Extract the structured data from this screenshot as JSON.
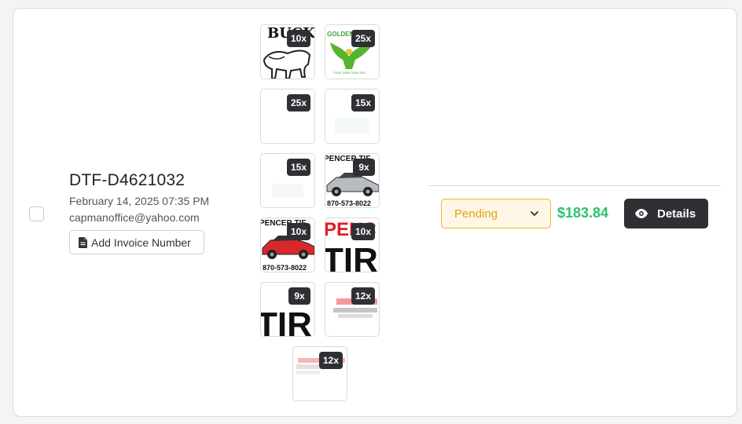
{
  "order": {
    "id": "DTF-D4621032",
    "date": "February 14, 2025 07:35 PM",
    "email": "capmanoffice@yahoo.com",
    "invoice_button": "Add Invoice Number"
  },
  "thumbnails": [
    {
      "qty": "10x",
      "art": "BUCK"
    },
    {
      "qty": "25x",
      "art_title": "GOLDEN",
      "art_sub": "STATE SWIM TEAM 2025"
    },
    {
      "qty": "25x"
    },
    {
      "qty": "15x"
    },
    {
      "qty": "15x"
    },
    {
      "qty": "9x",
      "art": "PENCER TIF",
      "art_sub": "870-573-8022"
    },
    {
      "qty": "10x",
      "art": "PENCER TIF",
      "art_sub": "870-573-8022"
    },
    {
      "qty": "10x",
      "art": "PENC",
      "art_sub": "TIR"
    },
    {
      "qty": "9x",
      "art": "TIR"
    },
    {
      "qty": "12x"
    },
    {
      "qty": "12x"
    }
  ],
  "status": {
    "value": "Pending",
    "color": "#e6a018"
  },
  "price": "$183.84",
  "details_button": "Details",
  "icons": [
    "file-icon",
    "chevron-down-icon",
    "eye-icon"
  ]
}
